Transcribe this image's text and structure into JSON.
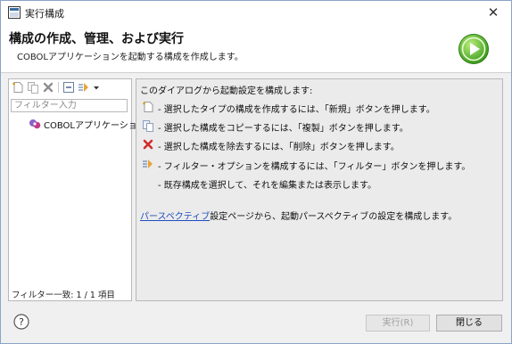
{
  "window": {
    "title": "実行構成",
    "close_glyph": "✕"
  },
  "banner": {
    "title": "構成の作成、管理、および実行",
    "subtitle": "COBOLアプリケーションを起動する構成を作成します。",
    "icon": "run-play-icon"
  },
  "left_panel": {
    "toolbar": [
      "new-configuration-icon",
      "duplicate-icon",
      "delete-icon",
      "collapse-all-icon",
      "filter-icon",
      "dropdown-chevron-icon"
    ],
    "filter_placeholder": "フィルター入力",
    "tree": [
      {
        "label": "COBOLアプリケーション",
        "icon": "cobol-app-icon"
      }
    ],
    "status": "フィルター一致: 1 / 1 項目"
  },
  "right_panel": {
    "intro": "このダイアログから起動設定を構成します:",
    "rows": [
      {
        "icon": "new-configuration-icon",
        "text": " - 選択したタイプの構成を作成するには、「新規」ボタンを押します。"
      },
      {
        "icon": "duplicate-icon",
        "text": " - 選択した構成をコピーするには、「複製」ボタンを押します。"
      },
      {
        "icon": "delete-icon",
        "text": " - 選択した構成を除去するには、「削除」ボタンを押します。"
      },
      {
        "icon": "filter-icon",
        "text": " - フィルター・オプションを構成するには、「フィルター」ボタンを押します。"
      },
      {
        "icon": "",
        "text": " - 既存構成を選択して、それを編集または表示します。"
      }
    ],
    "link_text": "パースペクティブ",
    "link_suffix": "設定ページから、起動パースペクティブの設定を構成します。"
  },
  "footer": {
    "help_glyph": "?",
    "run_label": "実行(R)",
    "close_label": "閉じる"
  }
}
